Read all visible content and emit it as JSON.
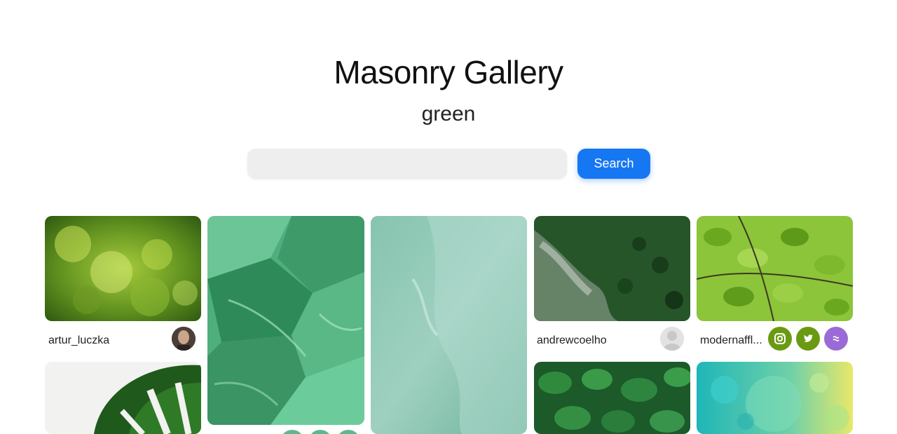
{
  "header": {
    "title": "Masonry Gallery",
    "subtitle": "green"
  },
  "search": {
    "value": "",
    "placeholder": "",
    "button_label": "Search"
  },
  "colors": {
    "accent": "#1677f2",
    "social_green": "#6a9a12",
    "social_purple": "#9a6ad6"
  },
  "cards": [
    {
      "user": "artur_luczka",
      "image": "green bokeh"
    },
    {
      "user": "",
      "image": "green malachite stone"
    },
    {
      "user": "",
      "image": "teal water texture"
    },
    {
      "user": "andrewcoelho",
      "image": "misty pine forest"
    },
    {
      "user": "modernaffl...",
      "image": "green leaves canopy"
    },
    {
      "user": "",
      "image": "monstera leaf"
    },
    {
      "user": "",
      "image": "green leaves"
    },
    {
      "user": "",
      "image": "turquoise bubbles"
    }
  ],
  "social_icons": [
    "instagram-icon",
    "twitter-icon",
    "link-icon"
  ]
}
